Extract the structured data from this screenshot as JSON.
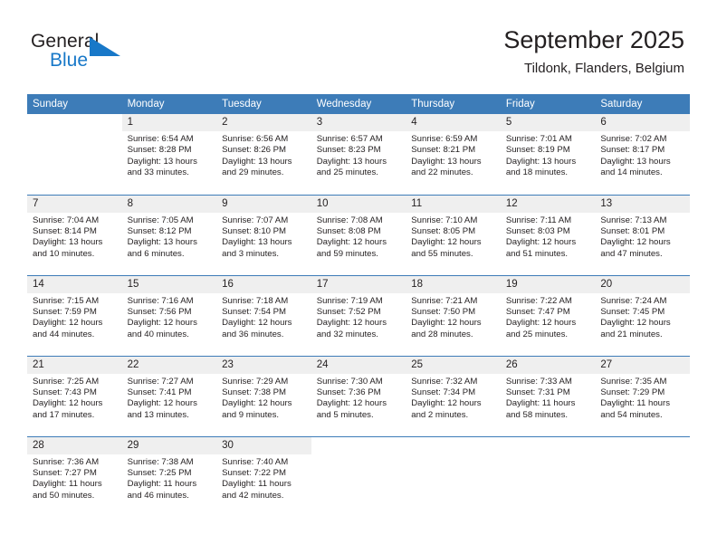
{
  "brand": {
    "name_part1": "General",
    "name_part2": "Blue",
    "triangle_color": "#1878c8",
    "text_color": "#231f20"
  },
  "header": {
    "title": "September 2025",
    "subtitle": "Tildonk, Flanders, Belgium"
  },
  "theme": {
    "header_blue": "#3d7cb8",
    "daynum_band": "#efefef",
    "text": "#231f20"
  },
  "weekdays": [
    "Sunday",
    "Monday",
    "Tuesday",
    "Wednesday",
    "Thursday",
    "Friday",
    "Saturday"
  ],
  "weeks": [
    [
      {
        "day": "",
        "sunrise": "",
        "sunset": "",
        "daylight_line1": "",
        "daylight_line2": "",
        "blank": true
      },
      {
        "day": "1",
        "sunrise": "Sunrise: 6:54 AM",
        "sunset": "Sunset: 8:28 PM",
        "daylight_line1": "Daylight: 13 hours",
        "daylight_line2": "and 33 minutes."
      },
      {
        "day": "2",
        "sunrise": "Sunrise: 6:56 AM",
        "sunset": "Sunset: 8:26 PM",
        "daylight_line1": "Daylight: 13 hours",
        "daylight_line2": "and 29 minutes."
      },
      {
        "day": "3",
        "sunrise": "Sunrise: 6:57 AM",
        "sunset": "Sunset: 8:23 PM",
        "daylight_line1": "Daylight: 13 hours",
        "daylight_line2": "and 25 minutes."
      },
      {
        "day": "4",
        "sunrise": "Sunrise: 6:59 AM",
        "sunset": "Sunset: 8:21 PM",
        "daylight_line1": "Daylight: 13 hours",
        "daylight_line2": "and 22 minutes."
      },
      {
        "day": "5",
        "sunrise": "Sunrise: 7:01 AM",
        "sunset": "Sunset: 8:19 PM",
        "daylight_line1": "Daylight: 13 hours",
        "daylight_line2": "and 18 minutes."
      },
      {
        "day": "6",
        "sunrise": "Sunrise: 7:02 AM",
        "sunset": "Sunset: 8:17 PM",
        "daylight_line1": "Daylight: 13 hours",
        "daylight_line2": "and 14 minutes."
      }
    ],
    [
      {
        "day": "7",
        "sunrise": "Sunrise: 7:04 AM",
        "sunset": "Sunset: 8:14 PM",
        "daylight_line1": "Daylight: 13 hours",
        "daylight_line2": "and 10 minutes."
      },
      {
        "day": "8",
        "sunrise": "Sunrise: 7:05 AM",
        "sunset": "Sunset: 8:12 PM",
        "daylight_line1": "Daylight: 13 hours",
        "daylight_line2": "and 6 minutes."
      },
      {
        "day": "9",
        "sunrise": "Sunrise: 7:07 AM",
        "sunset": "Sunset: 8:10 PM",
        "daylight_line1": "Daylight: 13 hours",
        "daylight_line2": "and 3 minutes."
      },
      {
        "day": "10",
        "sunrise": "Sunrise: 7:08 AM",
        "sunset": "Sunset: 8:08 PM",
        "daylight_line1": "Daylight: 12 hours",
        "daylight_line2": "and 59 minutes."
      },
      {
        "day": "11",
        "sunrise": "Sunrise: 7:10 AM",
        "sunset": "Sunset: 8:05 PM",
        "daylight_line1": "Daylight: 12 hours",
        "daylight_line2": "and 55 minutes."
      },
      {
        "day": "12",
        "sunrise": "Sunrise: 7:11 AM",
        "sunset": "Sunset: 8:03 PM",
        "daylight_line1": "Daylight: 12 hours",
        "daylight_line2": "and 51 minutes."
      },
      {
        "day": "13",
        "sunrise": "Sunrise: 7:13 AM",
        "sunset": "Sunset: 8:01 PM",
        "daylight_line1": "Daylight: 12 hours",
        "daylight_line2": "and 47 minutes."
      }
    ],
    [
      {
        "day": "14",
        "sunrise": "Sunrise: 7:15 AM",
        "sunset": "Sunset: 7:59 PM",
        "daylight_line1": "Daylight: 12 hours",
        "daylight_line2": "and 44 minutes."
      },
      {
        "day": "15",
        "sunrise": "Sunrise: 7:16 AM",
        "sunset": "Sunset: 7:56 PM",
        "daylight_line1": "Daylight: 12 hours",
        "daylight_line2": "and 40 minutes."
      },
      {
        "day": "16",
        "sunrise": "Sunrise: 7:18 AM",
        "sunset": "Sunset: 7:54 PM",
        "daylight_line1": "Daylight: 12 hours",
        "daylight_line2": "and 36 minutes."
      },
      {
        "day": "17",
        "sunrise": "Sunrise: 7:19 AM",
        "sunset": "Sunset: 7:52 PM",
        "daylight_line1": "Daylight: 12 hours",
        "daylight_line2": "and 32 minutes."
      },
      {
        "day": "18",
        "sunrise": "Sunrise: 7:21 AM",
        "sunset": "Sunset: 7:50 PM",
        "daylight_line1": "Daylight: 12 hours",
        "daylight_line2": "and 28 minutes."
      },
      {
        "day": "19",
        "sunrise": "Sunrise: 7:22 AM",
        "sunset": "Sunset: 7:47 PM",
        "daylight_line1": "Daylight: 12 hours",
        "daylight_line2": "and 25 minutes."
      },
      {
        "day": "20",
        "sunrise": "Sunrise: 7:24 AM",
        "sunset": "Sunset: 7:45 PM",
        "daylight_line1": "Daylight: 12 hours",
        "daylight_line2": "and 21 minutes."
      }
    ],
    [
      {
        "day": "21",
        "sunrise": "Sunrise: 7:25 AM",
        "sunset": "Sunset: 7:43 PM",
        "daylight_line1": "Daylight: 12 hours",
        "daylight_line2": "and 17 minutes."
      },
      {
        "day": "22",
        "sunrise": "Sunrise: 7:27 AM",
        "sunset": "Sunset: 7:41 PM",
        "daylight_line1": "Daylight: 12 hours",
        "daylight_line2": "and 13 minutes."
      },
      {
        "day": "23",
        "sunrise": "Sunrise: 7:29 AM",
        "sunset": "Sunset: 7:38 PM",
        "daylight_line1": "Daylight: 12 hours",
        "daylight_line2": "and 9 minutes."
      },
      {
        "day": "24",
        "sunrise": "Sunrise: 7:30 AM",
        "sunset": "Sunset: 7:36 PM",
        "daylight_line1": "Daylight: 12 hours",
        "daylight_line2": "and 5 minutes."
      },
      {
        "day": "25",
        "sunrise": "Sunrise: 7:32 AM",
        "sunset": "Sunset: 7:34 PM",
        "daylight_line1": "Daylight: 12 hours",
        "daylight_line2": "and 2 minutes."
      },
      {
        "day": "26",
        "sunrise": "Sunrise: 7:33 AM",
        "sunset": "Sunset: 7:31 PM",
        "daylight_line1": "Daylight: 11 hours",
        "daylight_line2": "and 58 minutes."
      },
      {
        "day": "27",
        "sunrise": "Sunrise: 7:35 AM",
        "sunset": "Sunset: 7:29 PM",
        "daylight_line1": "Daylight: 11 hours",
        "daylight_line2": "and 54 minutes."
      }
    ],
    [
      {
        "day": "28",
        "sunrise": "Sunrise: 7:36 AM",
        "sunset": "Sunset: 7:27 PM",
        "daylight_line1": "Daylight: 11 hours",
        "daylight_line2": "and 50 minutes."
      },
      {
        "day": "29",
        "sunrise": "Sunrise: 7:38 AM",
        "sunset": "Sunset: 7:25 PM",
        "daylight_line1": "Daylight: 11 hours",
        "daylight_line2": "and 46 minutes."
      },
      {
        "day": "30",
        "sunrise": "Sunrise: 7:40 AM",
        "sunset": "Sunset: 7:22 PM",
        "daylight_line1": "Daylight: 11 hours",
        "daylight_line2": "and 42 minutes."
      },
      {
        "day": "",
        "sunrise": "",
        "sunset": "",
        "daylight_line1": "",
        "daylight_line2": "",
        "blank": true
      },
      {
        "day": "",
        "sunrise": "",
        "sunset": "",
        "daylight_line1": "",
        "daylight_line2": "",
        "blank": true
      },
      {
        "day": "",
        "sunrise": "",
        "sunset": "",
        "daylight_line1": "",
        "daylight_line2": "",
        "blank": true
      },
      {
        "day": "",
        "sunrise": "",
        "sunset": "",
        "daylight_line1": "",
        "daylight_line2": "",
        "blank": true
      }
    ]
  ]
}
